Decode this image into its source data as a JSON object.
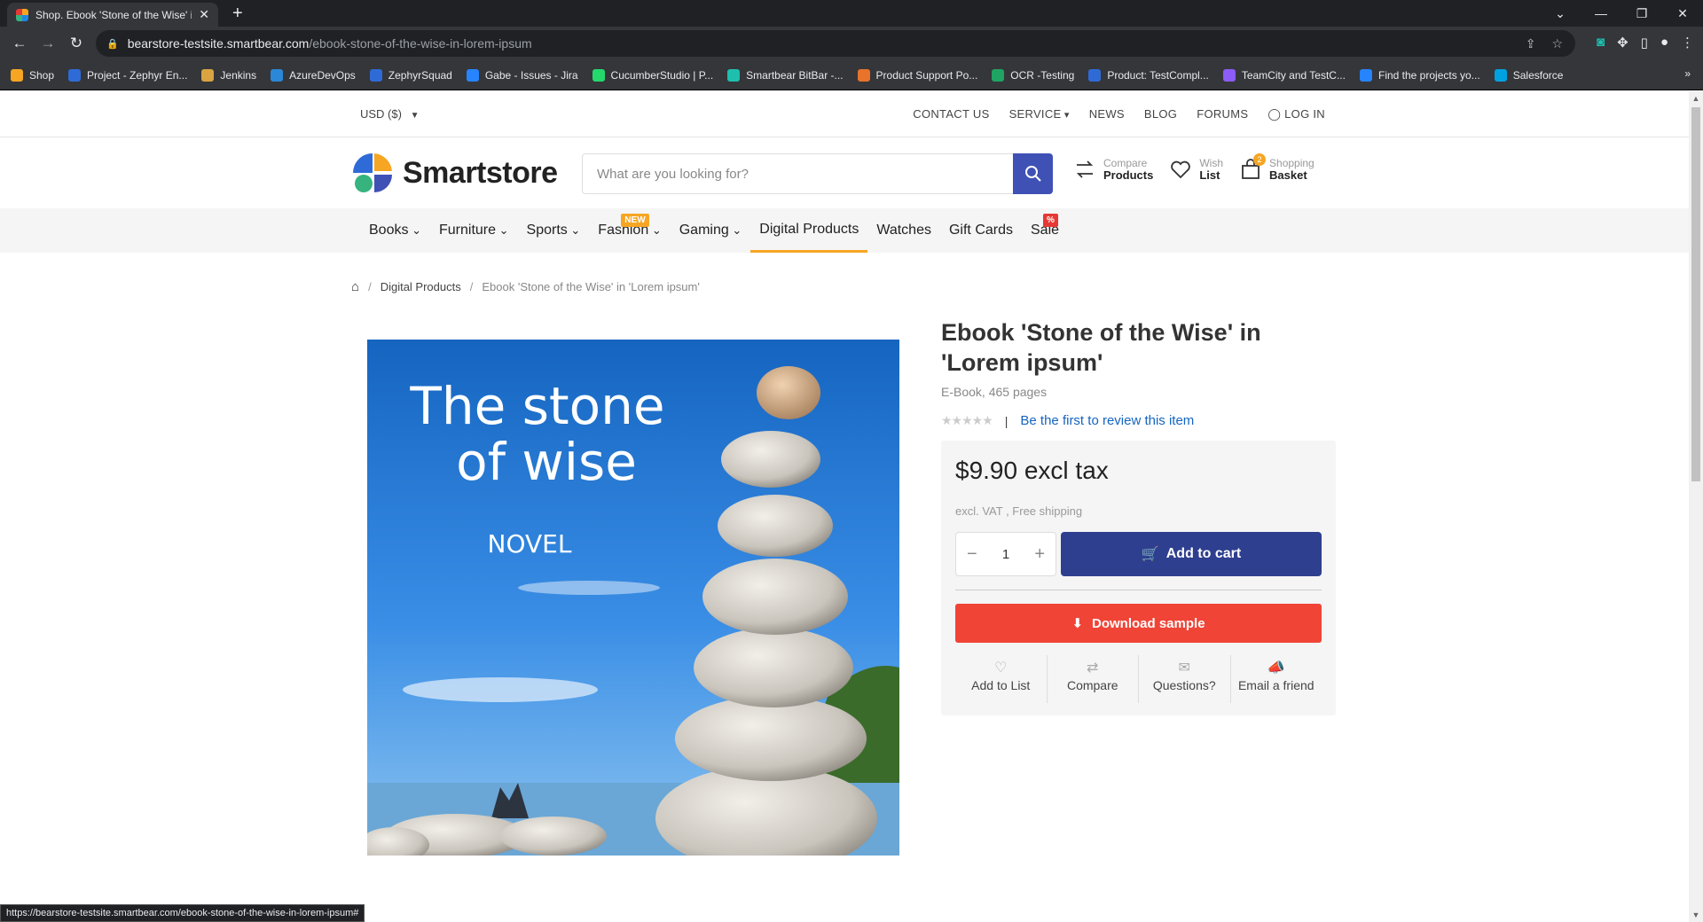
{
  "browser": {
    "tab_title": "Shop. Ebook 'Stone of the Wise' i",
    "url_host": "bearstore-testsite.smartbear.com",
    "url_path": "/ebook-stone-of-the-wise-in-lorem-ipsum",
    "bookmarks": [
      {
        "label": "Shop",
        "color": "#f6a623"
      },
      {
        "label": "Project - Zephyr En...",
        "color": "#2f6bd6"
      },
      {
        "label": "Jenkins",
        "color": "#d9a441"
      },
      {
        "label": "AzureDevOps",
        "color": "#2b88d8"
      },
      {
        "label": "ZephyrSquad",
        "color": "#2f6bd6"
      },
      {
        "label": "Gabe - Issues - Jira",
        "color": "#2684ff"
      },
      {
        "label": "CucumberStudio | P...",
        "color": "#23d96c"
      },
      {
        "label": "Smartbear BitBar -...",
        "color": "#1fbfae"
      },
      {
        "label": "Product Support Po...",
        "color": "#e8732a"
      },
      {
        "label": "OCR -Testing",
        "color": "#1fa463"
      },
      {
        "label": "Product: TestCompl...",
        "color": "#2f6bd6"
      },
      {
        "label": "TeamCity and TestC...",
        "color": "#8b5cf6"
      },
      {
        "label": "Find the projects yo...",
        "color": "#2684ff"
      },
      {
        "label": "Salesforce",
        "color": "#00a1e0"
      }
    ],
    "status_url": "https://bearstore-testsite.smartbear.com/ebook-stone-of-the-wise-in-lorem-ipsum#"
  },
  "topbar": {
    "currency": "USD  ($)",
    "links": [
      "CONTACT US",
      "SERVICE",
      "NEWS",
      "BLOG",
      "FORUMS",
      "LOG IN"
    ]
  },
  "header": {
    "logo": "Smartstore",
    "search_placeholder": "What are you looking for?",
    "compare_top": "Compare",
    "compare_bottom": "Products",
    "wish_top": "Wish",
    "wish_bottom": "List",
    "basket_top": "Shopping",
    "basket_bottom": "Basket",
    "basket_count": "2"
  },
  "categories": [
    {
      "label": "Books",
      "chevron": true
    },
    {
      "label": "Furniture",
      "chevron": true
    },
    {
      "label": "Sports",
      "chevron": true
    },
    {
      "label": "Fashion",
      "chevron": true,
      "badge": "NEW"
    },
    {
      "label": "Gaming",
      "chevron": true
    },
    {
      "label": "Digital Products",
      "active": true
    },
    {
      "label": "Watches"
    },
    {
      "label": "Gift Cards"
    },
    {
      "label": "Sale",
      "badge": "%"
    }
  ],
  "breadcrumb": {
    "parent": "Digital Products",
    "current": "Ebook 'Stone of the Wise' in 'Lorem ipsum'"
  },
  "product": {
    "title": "Ebook 'Stone of the Wise' in 'Lorem ipsum'",
    "subtitle": "E-Book, 465 pages",
    "review_link": "Be the first to review this item",
    "price": "$9.90 excl tax",
    "vat_note": "excl. VAT , Free shipping",
    "quantity": "1",
    "add_to_cart": "Add to cart",
    "download_sample": "Download sample",
    "actions": [
      "Add to List",
      "Compare",
      "Questions?",
      "Email a friend"
    ],
    "cover_title_1": "The stone",
    "cover_title_2": "of wise",
    "cover_sub": "NOVEL"
  },
  "colors": {
    "accent": "#3f51b5",
    "cart_button": "#2f3f8f",
    "sample_button": "#f04437",
    "active_underline": "#f6a623",
    "link": "#1565c0"
  }
}
